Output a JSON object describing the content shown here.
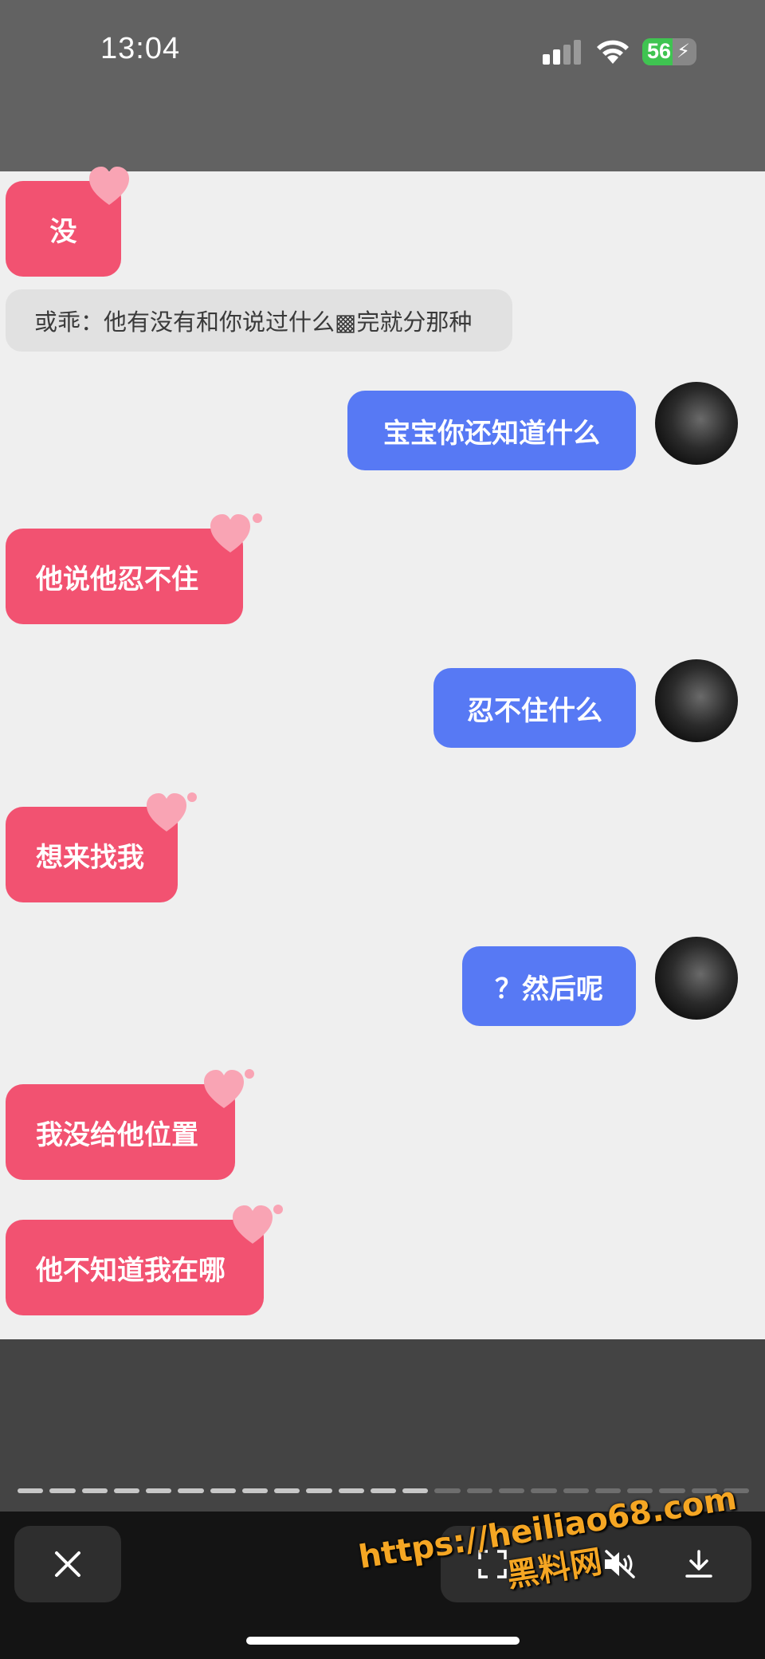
{
  "status_bar": {
    "time": "13:04",
    "battery": "56"
  },
  "chat": {
    "system_message": "或乖：他有没有和你说过什么▩完就分那种",
    "messages": [
      {
        "side": "left",
        "text": "没"
      },
      {
        "side": "right",
        "text": "宝宝你还知道什么"
      },
      {
        "side": "left",
        "text": "他说他忍不住"
      },
      {
        "side": "right",
        "text": "忍不住什么"
      },
      {
        "side": "left",
        "text": "想来找我"
      },
      {
        "side": "right",
        "text": "？然后呢"
      },
      {
        "side": "left",
        "text": "我没给他位置"
      },
      {
        "side": "left",
        "text": "他不知道我在哪"
      }
    ]
  },
  "progress": {
    "segments": 23,
    "completed": 13
  },
  "toolbar": {
    "close_icon": "close-icon",
    "scan_icon": "scan-icon",
    "mute_icon": "speaker-muted-icon",
    "download_icon": "download-icon"
  },
  "watermark": {
    "line1": "https://heiliao68.com",
    "line2": "黑料网"
  },
  "colors": {
    "pink": "#f25271",
    "blue": "#5779f4",
    "battery": "#3fc451"
  }
}
